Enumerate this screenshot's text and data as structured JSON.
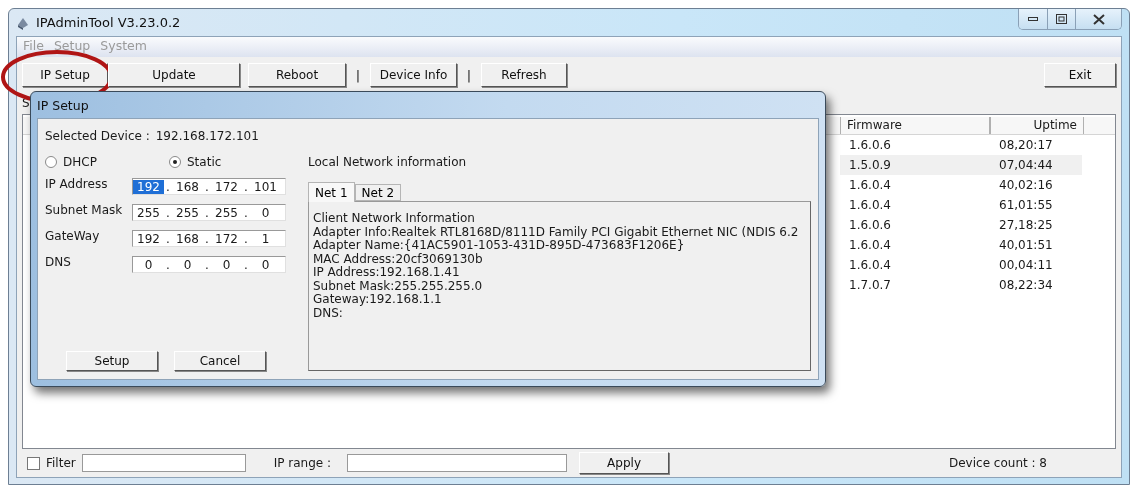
{
  "window": {
    "title": "IPAdminTool V3.23.0.2"
  },
  "menu": [
    {
      "label": "File",
      "disabled": true
    },
    {
      "label": "Setup",
      "disabled": true
    },
    {
      "label": "System",
      "disabled": true
    }
  ],
  "toolbar": [
    {
      "kind": "button",
      "label": "IP Setup",
      "circled": true
    },
    {
      "kind": "button",
      "label": "Update",
      "circled": false
    },
    {
      "kind": "button",
      "label": "Reboot",
      "circled": false
    },
    {
      "kind": "separator",
      "label": "|"
    },
    {
      "kind": "button",
      "label": "Device Info",
      "circled": false
    },
    {
      "kind": "separator",
      "label": "|"
    },
    {
      "kind": "button",
      "label": "Refresh",
      "circled": false
    }
  ],
  "exit_button": "Exit",
  "label_1": "S",
  "table": {
    "columns": [
      "Firmware",
      "Uptime"
    ],
    "rows": [
      {
        "cells": [
          "1.6.0.6",
          "08,20:17"
        ],
        "selected": false
      },
      {
        "cells": [
          "1.5.0.9",
          "07,04:44"
        ],
        "selected": true
      },
      {
        "cells": [
          "1.6.0.4",
          "40,02:16"
        ],
        "selected": false
      },
      {
        "cells": [
          "1.6.0.4",
          "61,01:55"
        ],
        "selected": false
      },
      {
        "cells": [
          "1.6.0.6",
          "27,18:25"
        ],
        "selected": false
      },
      {
        "cells": [
          "1.6.0.4",
          "40,01:51"
        ],
        "selected": false
      },
      {
        "cells": [
          "1.6.0.4",
          "00,04:11"
        ],
        "selected": false
      },
      {
        "cells": [
          "1.7.0.7",
          "08,22:34"
        ],
        "selected": false
      }
    ]
  },
  "dialog": {
    "title": "IP Setup",
    "selected_device_label": "Selected Device :",
    "selected_device": "192.168.172.101",
    "modes": [
      {
        "label": "DHCP",
        "selected": false
      },
      {
        "label": "Static",
        "selected": true
      }
    ],
    "fields": [
      {
        "label": "IP Address",
        "parts": [
          {
            "kind": "octet",
            "value": "192",
            "selected": true
          },
          {
            "kind": "dot",
            "value": "."
          },
          {
            "kind": "octet",
            "value": "168",
            "selected": false
          },
          {
            "kind": "dot",
            "value": "."
          },
          {
            "kind": "octet",
            "value": "172",
            "selected": false
          },
          {
            "kind": "dot",
            "value": "."
          },
          {
            "kind": "octet",
            "value": "101",
            "selected": false
          }
        ]
      },
      {
        "label": "Subnet Mask",
        "parts": [
          {
            "kind": "octet",
            "value": "255",
            "selected": false
          },
          {
            "kind": "dot",
            "value": "."
          },
          {
            "kind": "octet",
            "value": "255",
            "selected": false
          },
          {
            "kind": "dot",
            "value": "."
          },
          {
            "kind": "octet",
            "value": "255",
            "selected": false
          },
          {
            "kind": "dot",
            "value": "."
          },
          {
            "kind": "octet",
            "value": "0",
            "selected": false
          }
        ]
      },
      {
        "label": "GateWay",
        "parts": [
          {
            "kind": "octet",
            "value": "192",
            "selected": false
          },
          {
            "kind": "dot",
            "value": "."
          },
          {
            "kind": "octet",
            "value": "168",
            "selected": false
          },
          {
            "kind": "dot",
            "value": "."
          },
          {
            "kind": "octet",
            "value": "172",
            "selected": false
          },
          {
            "kind": "dot",
            "value": "."
          },
          {
            "kind": "octet",
            "value": "1",
            "selected": false
          }
        ]
      },
      {
        "label": "DNS",
        "parts": [
          {
            "kind": "octet",
            "value": "0",
            "selected": false
          },
          {
            "kind": "dot",
            "value": "."
          },
          {
            "kind": "octet",
            "value": "0",
            "selected": false
          },
          {
            "kind": "dot",
            "value": "."
          },
          {
            "kind": "octet",
            "value": "0",
            "selected": false
          },
          {
            "kind": "dot",
            "value": "."
          },
          {
            "kind": "octet",
            "value": "0",
            "selected": false
          }
        ]
      }
    ],
    "buttons": [
      "Setup",
      "Cancel"
    ],
    "local_network": {
      "title": "Local Network information",
      "tabs": [
        {
          "label": "Net 1",
          "selected": true
        },
        {
          "label": "Net 2",
          "selected": false
        }
      ],
      "lines": [
        "Client Network Information",
        "Adapter Info:Realtek RTL8168D/8111D Family PCI Gigabit Ethernet NIC (NDIS 6.2",
        "Adapter Name:{41AC5901-1053-431D-895D-473683F1206E}",
        "MAC Address:20cf3069130b",
        "IP Address:192.168.1.41",
        "Subnet Mask:255.255.255.0",
        "Gateway:192.168.1.1",
        "DNS:"
      ]
    }
  },
  "bottom_bar": {
    "filter": {
      "label": "Filter",
      "checked": false
    },
    "ip_range_label": "IP range :",
    "apply_button": "Apply",
    "device_count": "Device count : 8"
  }
}
